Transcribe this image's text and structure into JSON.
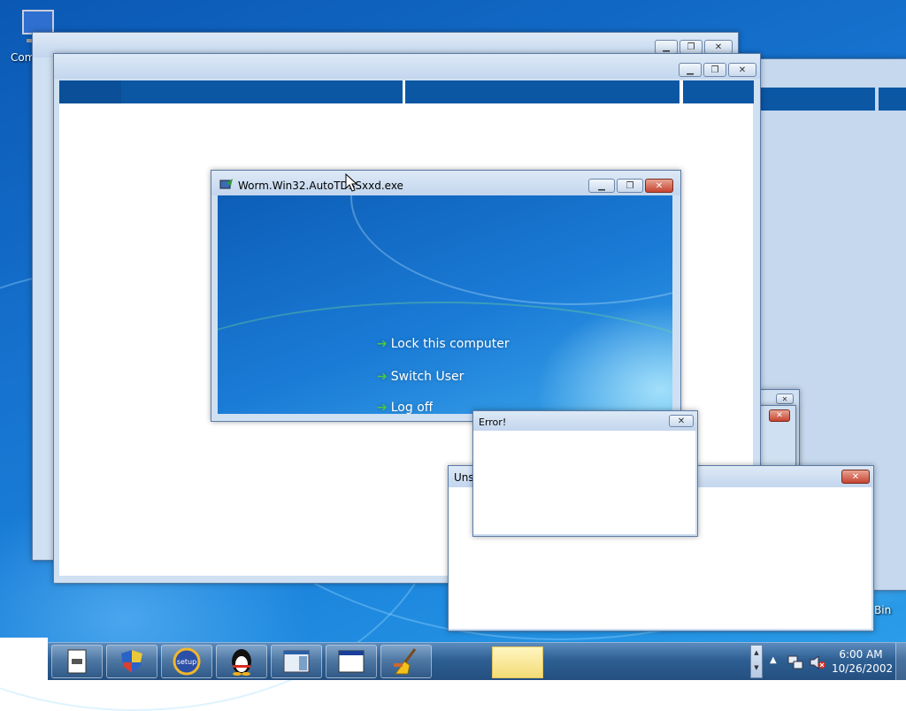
{
  "desktop": {
    "icons": [
      {
        "label": "Com",
        "icon": "computer-icon"
      },
      {
        "label": "Bin",
        "icon": "recycle-bin-icon"
      }
    ]
  },
  "windows": {
    "main_window": {
      "title": "Worm.Win32.AutoTDSSxxd.exe",
      "icon": "worm-exe-icon"
    },
    "logon_menu": {
      "items": [
        {
          "label": "Lock this computer",
          "icon": "green-arrow-icon"
        },
        {
          "label": "Switch User",
          "icon": "green-arrow-icon"
        },
        {
          "label": "Log off",
          "icon": "green-arrow-icon"
        }
      ]
    },
    "error_dialog": {
      "title": "Error!"
    },
    "uns_dialog": {
      "title": "Uns"
    }
  },
  "taskbar": {
    "buttons": [
      {
        "name": "document-app",
        "icon": "document-icon"
      },
      {
        "name": "security-shield",
        "icon": "shield-icon"
      },
      {
        "name": "setup-app",
        "icon": "setup-icon"
      },
      {
        "name": "qq-app",
        "icon": "penguin-icon"
      },
      {
        "name": "window-app-1",
        "icon": "window-icon"
      },
      {
        "name": "window-app-2",
        "icon": "window-icon"
      },
      {
        "name": "cleaner-app",
        "icon": "broom-icon"
      }
    ],
    "tray": {
      "time": "6:00 AM",
      "date": "10/26/2002",
      "icons": [
        "show-hidden-icons-arrow",
        "network-icon",
        "volume-muted-icon"
      ]
    }
  },
  "colors": {
    "desktop_blue": "#1673cf",
    "taskbar_blue": "#2e5f93",
    "close_red": "#c64431",
    "nav_strip": "#0b57a4"
  }
}
